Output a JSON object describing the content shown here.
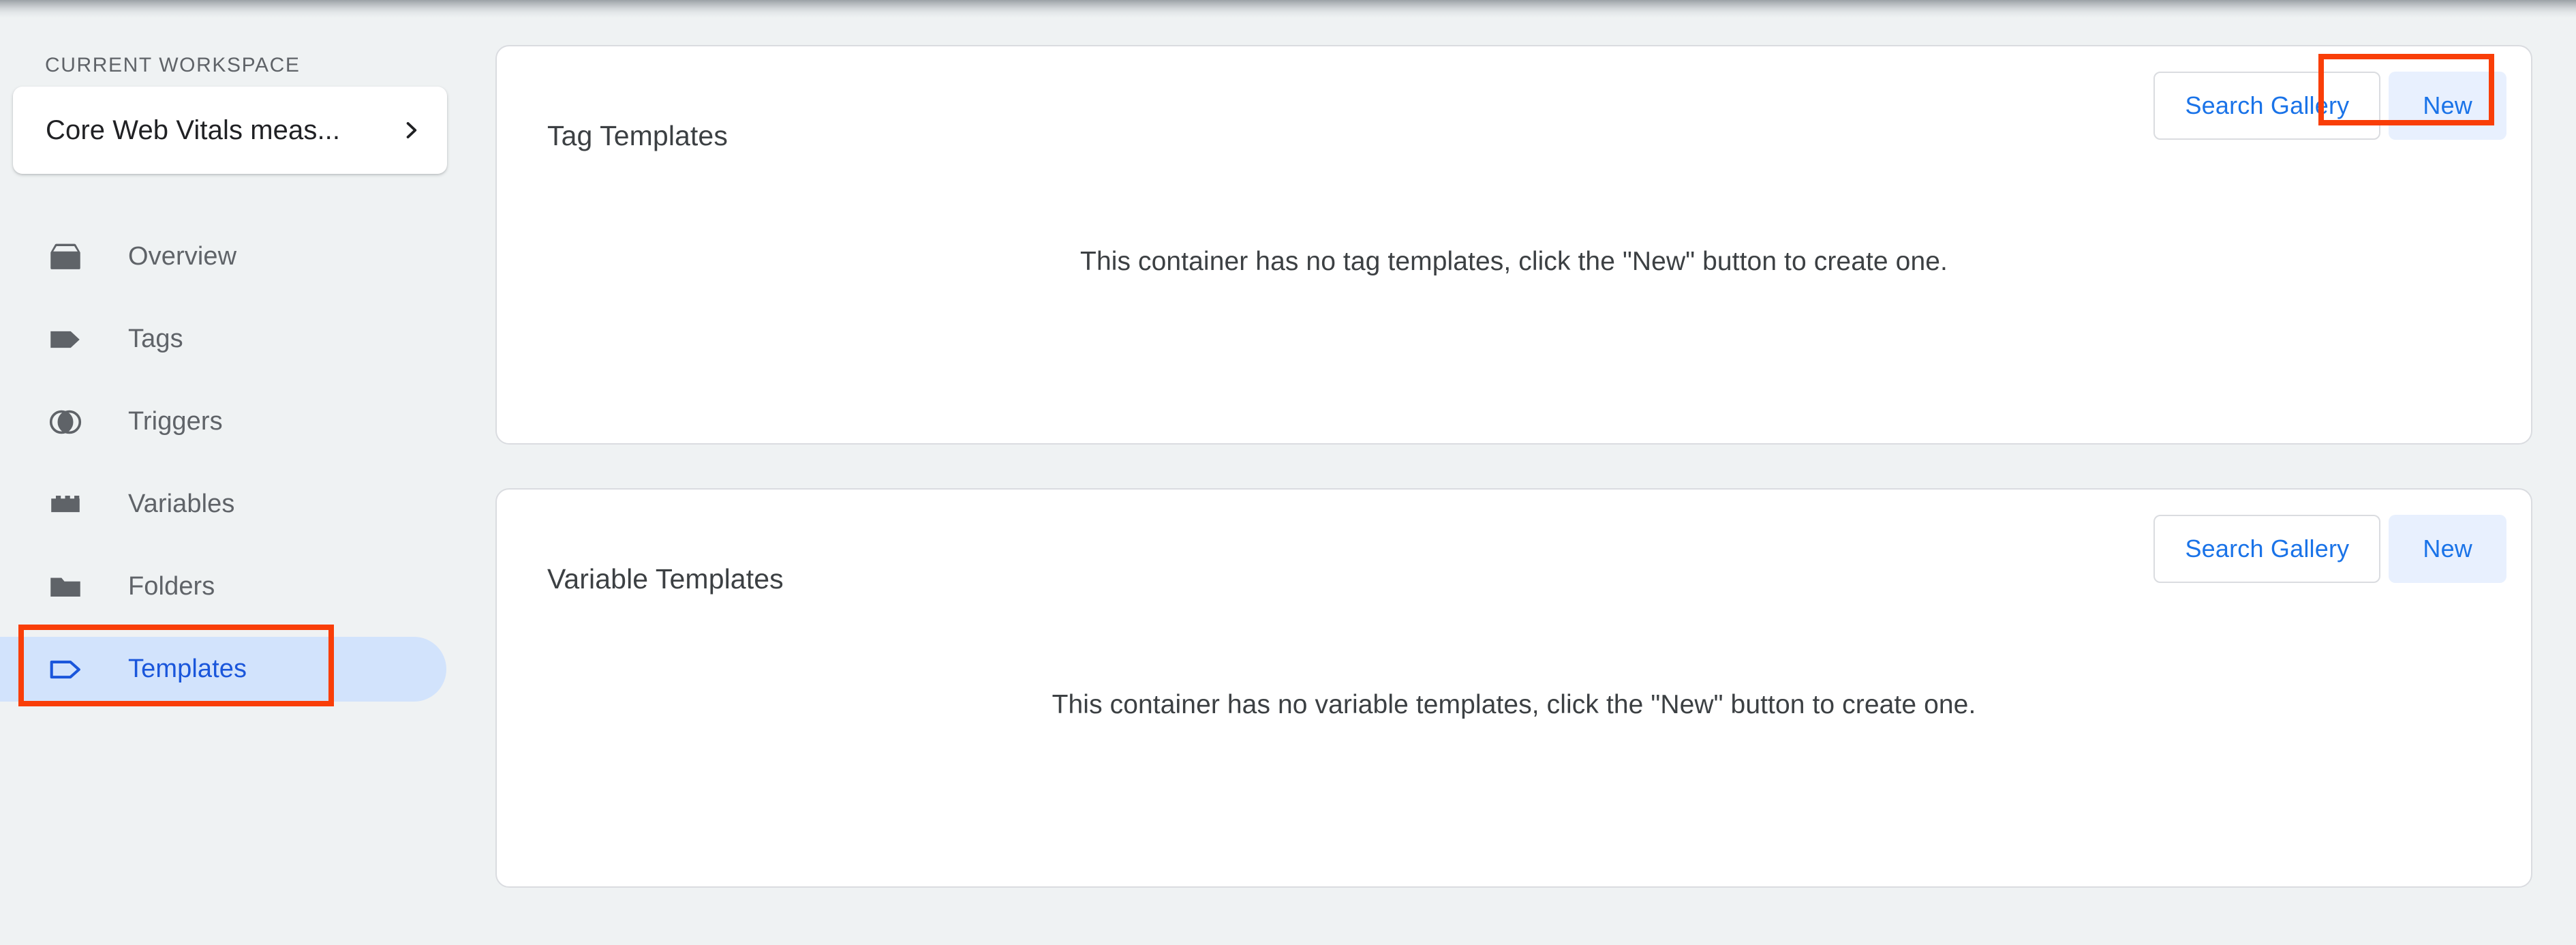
{
  "sidebar": {
    "workspace_section_label": "CURRENT WORKSPACE",
    "workspace_name": "Core Web Vitals meas...",
    "chevron_icon": "chevron-right-icon",
    "nav_items": [
      {
        "label": "Overview",
        "icon": "overview-box-icon",
        "active": false
      },
      {
        "label": "Tags",
        "icon": "tag-filled-icon",
        "active": false
      },
      {
        "label": "Triggers",
        "icon": "triggers-circles-icon",
        "active": false
      },
      {
        "label": "Variables",
        "icon": "variables-block-icon",
        "active": false
      },
      {
        "label": "Folders",
        "icon": "folder-icon",
        "active": false
      },
      {
        "label": "Templates",
        "icon": "tag-outline-icon",
        "active": true
      }
    ]
  },
  "main": {
    "cards": [
      {
        "title": "Tag Templates",
        "search_label": "Search Gallery",
        "new_label": "New",
        "empty_text": "This container has no tag templates, click the \"New\" button to create one."
      },
      {
        "title": "Variable Templates",
        "search_label": "Search Gallery",
        "new_label": "New",
        "empty_text": "This container has no variable templates, click the \"New\" button to create one."
      }
    ]
  },
  "annotations": {
    "highlight_color": "#f93e08",
    "highlighted_elements": [
      "sidebar-item-templates",
      "tag-templates-new-button"
    ]
  },
  "colors": {
    "page_background": "#eff2f3",
    "card_background": "#ffffff",
    "card_border": "#dadce0",
    "accent_blue": "#1a73e8",
    "active_nav_pill": "#d2e3fc",
    "active_nav_text": "#1a56db",
    "tonal_button_background": "#e8f0fe",
    "icon_gray": "#5f6368"
  }
}
